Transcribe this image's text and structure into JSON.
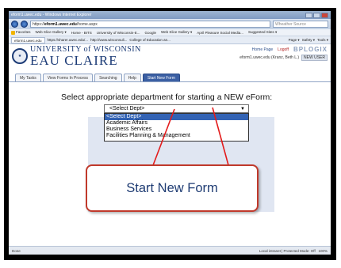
{
  "window": {
    "title": "eform1.uwec.edu - Windows Internet Explorer"
  },
  "address": {
    "url_prefix": "https://",
    "url_host": "eform1.uwec.edu",
    "url_rest": "/home.aspx",
    "search_placeholder": "Wheather Source"
  },
  "favorites": [
    "Favorites",
    "Web Slice Gallery ▾",
    "Home - BITS",
    "University of Wisconsin-E...",
    "Google",
    "Web Slice Gallery ▾",
    "April Pleasure Social Media...",
    "Suggested Sites ▾"
  ],
  "tabs_bar": {
    "tab1": "eform1.uwec.edu",
    "tab2": "https://sharer.uwec.edu/...",
    "tab3": "http://www.wisconsuli...",
    "tab4": "College of Education an..."
  },
  "cmd": {
    "page": "Page ▾",
    "safety": "Safety ▾",
    "tools": "Tools ▾"
  },
  "brand": {
    "university": "UNIVERSITY of WISCONSIN",
    "campus": "EAU CLAIRE"
  },
  "header": {
    "home": "Home Page",
    "logoff": "Logoff",
    "bplogix": "BPLOGIX",
    "user": "eform1.uwec.edu (Kranz, Beth L.)",
    "new_user": "NEW USER"
  },
  "nav_tabs": [
    "My Tasks",
    "View Forms In Process",
    "Searching",
    "Help",
    "Start New Form"
  ],
  "main": {
    "prompt": "Select appropriate department for starting a NEW eForm:",
    "select_value": "<Select Dept>",
    "options": [
      "<Select Dept>",
      "Academic Affairs",
      "Business Services",
      "Facilities Planning & Management"
    ]
  },
  "callout": "Start New Form",
  "status": {
    "left": "Done",
    "zone": "Local intranet | Protected Mode: Off",
    "zoom": "100%"
  },
  "colors": {
    "callout_border": "#c0392b",
    "accent": "#3b5fa3",
    "line": "#e31b1b"
  }
}
